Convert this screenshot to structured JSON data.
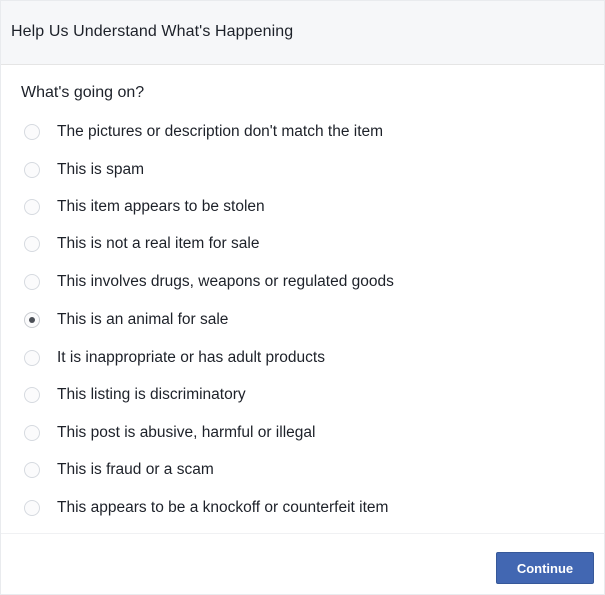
{
  "dialog": {
    "title": "Help Us Understand What's Happening",
    "question": "What's going on?",
    "selected_index": 5,
    "options": [
      "The pictures or description don't match the item",
      "This is spam",
      "This item appears to be stolen",
      "This is not a real item for sale",
      "This involves drugs, weapons or regulated goods",
      "This is an animal for sale",
      "It is inappropriate or has adult products",
      "This listing is discriminatory",
      "This post is abusive, harmful or illegal",
      "This is fraud or a scam",
      "This appears to be a knockoff or counterfeit item"
    ],
    "continue_label": "Continue",
    "colors": {
      "button_bg": "#4267b2",
      "header_bg": "#f6f7f9"
    }
  }
}
